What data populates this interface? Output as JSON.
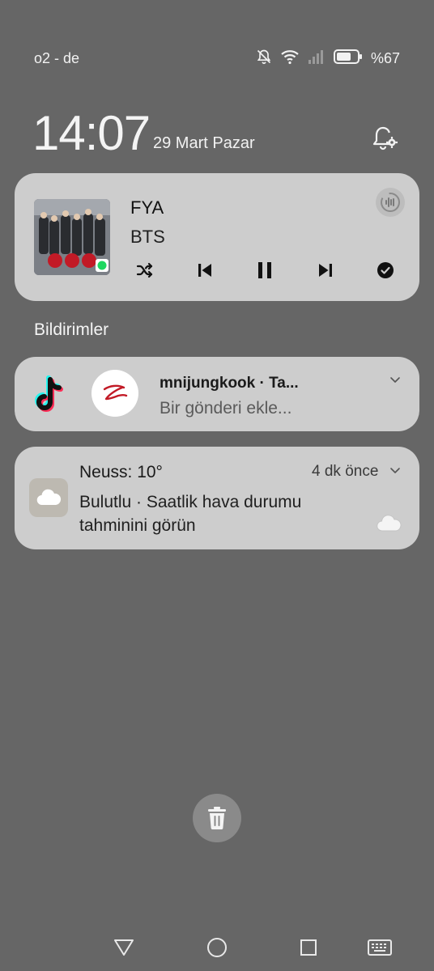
{
  "status_bar": {
    "carrier": "o2 - de",
    "battery_percent": "%67",
    "icons": [
      "mute-icon",
      "wifi-icon",
      "signal-icon",
      "battery-icon"
    ]
  },
  "lockscreen": {
    "time": "14:07",
    "date": "29 Mart Pazar"
  },
  "media": {
    "title": "FYA",
    "artist": "BTS",
    "controls": [
      "shuffle-icon",
      "previous-icon",
      "pause-icon",
      "next-icon",
      "check-icon"
    ]
  },
  "notifications": {
    "section_title": "Bildirimler",
    "tiktok": {
      "title": "mnijungkook · Ta...",
      "body": "Bir gönderi ekle..."
    },
    "weather": {
      "title": "Neuss: 10°",
      "time": "4 dk önce",
      "body": "Bulutlu · Saatlik hava durumu tahminini görün"
    }
  },
  "colors": {
    "background": "#666666",
    "card": "#cdcdcd",
    "tiktok_cyan": "#25f4ee",
    "tiktok_red": "#fe2c55",
    "spotify_green": "#1ed760"
  }
}
